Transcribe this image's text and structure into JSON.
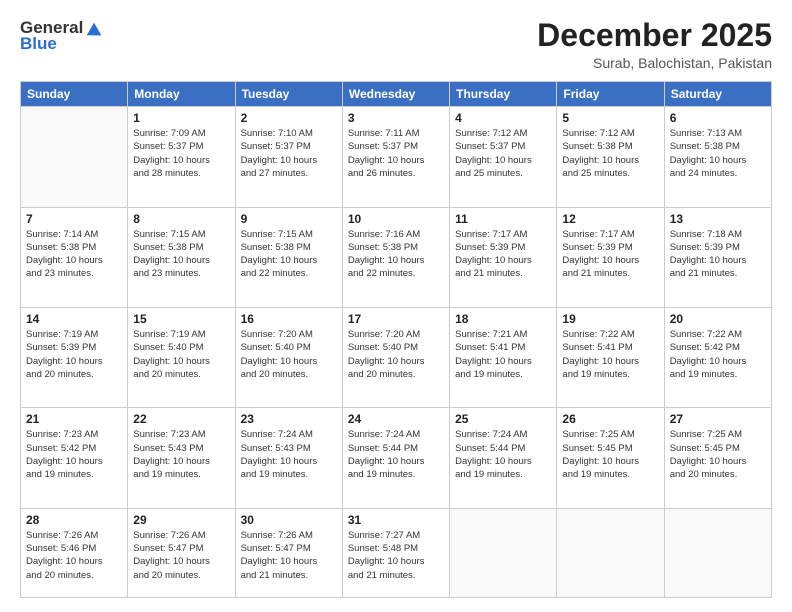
{
  "header": {
    "logo_general": "General",
    "logo_blue": "Blue",
    "month": "December 2025",
    "location": "Surab, Balochistan, Pakistan"
  },
  "days": [
    "Sunday",
    "Monday",
    "Tuesday",
    "Wednesday",
    "Thursday",
    "Friday",
    "Saturday"
  ],
  "weeks": [
    [
      {
        "day": "",
        "content": []
      },
      {
        "day": "1",
        "content": [
          "Sunrise: 7:09 AM",
          "Sunset: 5:37 PM",
          "Daylight: 10 hours",
          "and 28 minutes."
        ]
      },
      {
        "day": "2",
        "content": [
          "Sunrise: 7:10 AM",
          "Sunset: 5:37 PM",
          "Daylight: 10 hours",
          "and 27 minutes."
        ]
      },
      {
        "day": "3",
        "content": [
          "Sunrise: 7:11 AM",
          "Sunset: 5:37 PM",
          "Daylight: 10 hours",
          "and 26 minutes."
        ]
      },
      {
        "day": "4",
        "content": [
          "Sunrise: 7:12 AM",
          "Sunset: 5:37 PM",
          "Daylight: 10 hours",
          "and 25 minutes."
        ]
      },
      {
        "day": "5",
        "content": [
          "Sunrise: 7:12 AM",
          "Sunset: 5:38 PM",
          "Daylight: 10 hours",
          "and 25 minutes."
        ]
      },
      {
        "day": "6",
        "content": [
          "Sunrise: 7:13 AM",
          "Sunset: 5:38 PM",
          "Daylight: 10 hours",
          "and 24 minutes."
        ]
      }
    ],
    [
      {
        "day": "7",
        "content": [
          "Sunrise: 7:14 AM",
          "Sunset: 5:38 PM",
          "Daylight: 10 hours",
          "and 23 minutes."
        ]
      },
      {
        "day": "8",
        "content": [
          "Sunrise: 7:15 AM",
          "Sunset: 5:38 PM",
          "Daylight: 10 hours",
          "and 23 minutes."
        ]
      },
      {
        "day": "9",
        "content": [
          "Sunrise: 7:15 AM",
          "Sunset: 5:38 PM",
          "Daylight: 10 hours",
          "and 22 minutes."
        ]
      },
      {
        "day": "10",
        "content": [
          "Sunrise: 7:16 AM",
          "Sunset: 5:38 PM",
          "Daylight: 10 hours",
          "and 22 minutes."
        ]
      },
      {
        "day": "11",
        "content": [
          "Sunrise: 7:17 AM",
          "Sunset: 5:39 PM",
          "Daylight: 10 hours",
          "and 21 minutes."
        ]
      },
      {
        "day": "12",
        "content": [
          "Sunrise: 7:17 AM",
          "Sunset: 5:39 PM",
          "Daylight: 10 hours",
          "and 21 minutes."
        ]
      },
      {
        "day": "13",
        "content": [
          "Sunrise: 7:18 AM",
          "Sunset: 5:39 PM",
          "Daylight: 10 hours",
          "and 21 minutes."
        ]
      }
    ],
    [
      {
        "day": "14",
        "content": [
          "Sunrise: 7:19 AM",
          "Sunset: 5:39 PM",
          "Daylight: 10 hours",
          "and 20 minutes."
        ]
      },
      {
        "day": "15",
        "content": [
          "Sunrise: 7:19 AM",
          "Sunset: 5:40 PM",
          "Daylight: 10 hours",
          "and 20 minutes."
        ]
      },
      {
        "day": "16",
        "content": [
          "Sunrise: 7:20 AM",
          "Sunset: 5:40 PM",
          "Daylight: 10 hours",
          "and 20 minutes."
        ]
      },
      {
        "day": "17",
        "content": [
          "Sunrise: 7:20 AM",
          "Sunset: 5:40 PM",
          "Daylight: 10 hours",
          "and 20 minutes."
        ]
      },
      {
        "day": "18",
        "content": [
          "Sunrise: 7:21 AM",
          "Sunset: 5:41 PM",
          "Daylight: 10 hours",
          "and 19 minutes."
        ]
      },
      {
        "day": "19",
        "content": [
          "Sunrise: 7:22 AM",
          "Sunset: 5:41 PM",
          "Daylight: 10 hours",
          "and 19 minutes."
        ]
      },
      {
        "day": "20",
        "content": [
          "Sunrise: 7:22 AM",
          "Sunset: 5:42 PM",
          "Daylight: 10 hours",
          "and 19 minutes."
        ]
      }
    ],
    [
      {
        "day": "21",
        "content": [
          "Sunrise: 7:23 AM",
          "Sunset: 5:42 PM",
          "Daylight: 10 hours",
          "and 19 minutes."
        ]
      },
      {
        "day": "22",
        "content": [
          "Sunrise: 7:23 AM",
          "Sunset: 5:43 PM",
          "Daylight: 10 hours",
          "and 19 minutes."
        ]
      },
      {
        "day": "23",
        "content": [
          "Sunrise: 7:24 AM",
          "Sunset: 5:43 PM",
          "Daylight: 10 hours",
          "and 19 minutes."
        ]
      },
      {
        "day": "24",
        "content": [
          "Sunrise: 7:24 AM",
          "Sunset: 5:44 PM",
          "Daylight: 10 hours",
          "and 19 minutes."
        ]
      },
      {
        "day": "25",
        "content": [
          "Sunrise: 7:24 AM",
          "Sunset: 5:44 PM",
          "Daylight: 10 hours",
          "and 19 minutes."
        ]
      },
      {
        "day": "26",
        "content": [
          "Sunrise: 7:25 AM",
          "Sunset: 5:45 PM",
          "Daylight: 10 hours",
          "and 19 minutes."
        ]
      },
      {
        "day": "27",
        "content": [
          "Sunrise: 7:25 AM",
          "Sunset: 5:45 PM",
          "Daylight: 10 hours",
          "and 20 minutes."
        ]
      }
    ],
    [
      {
        "day": "28",
        "content": [
          "Sunrise: 7:26 AM",
          "Sunset: 5:46 PM",
          "Daylight: 10 hours",
          "and 20 minutes."
        ]
      },
      {
        "day": "29",
        "content": [
          "Sunrise: 7:26 AM",
          "Sunset: 5:47 PM",
          "Daylight: 10 hours",
          "and 20 minutes."
        ]
      },
      {
        "day": "30",
        "content": [
          "Sunrise: 7:26 AM",
          "Sunset: 5:47 PM",
          "Daylight: 10 hours",
          "and 21 minutes."
        ]
      },
      {
        "day": "31",
        "content": [
          "Sunrise: 7:27 AM",
          "Sunset: 5:48 PM",
          "Daylight: 10 hours",
          "and 21 minutes."
        ]
      },
      {
        "day": "",
        "content": []
      },
      {
        "day": "",
        "content": []
      },
      {
        "day": "",
        "content": []
      }
    ]
  ]
}
